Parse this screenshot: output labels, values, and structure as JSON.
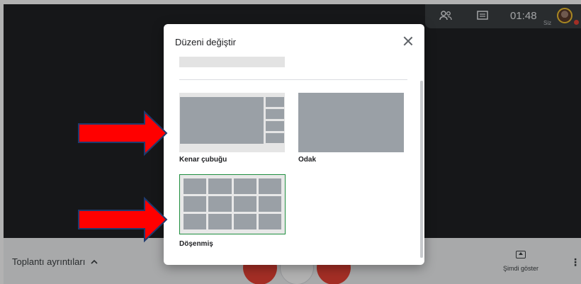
{
  "app": {
    "clock": "01:48",
    "you_label": "Siz",
    "meeting_details_label": "Toplantı ayrıntıları",
    "present_now_label": "Şimdi göster"
  },
  "dialog": {
    "title": "Düzeni değiştir",
    "options": [
      {
        "label": "Kenar çubuğu",
        "selected": false
      },
      {
        "label": "Odak",
        "selected": false
      },
      {
        "label": "Döşenmiş",
        "selected": true
      }
    ]
  },
  "colors": {
    "meet_background": "#202124",
    "selected_outline": "#1e8e3e",
    "arrow_fill": "#ff0000",
    "arrow_outline": "#1f3a6e",
    "end_call": "#ea4335"
  },
  "icons": [
    "people-icon",
    "chat-icon",
    "close-icon",
    "chevron-up-icon",
    "present-icon",
    "more-vert-icon",
    "avatar"
  ]
}
